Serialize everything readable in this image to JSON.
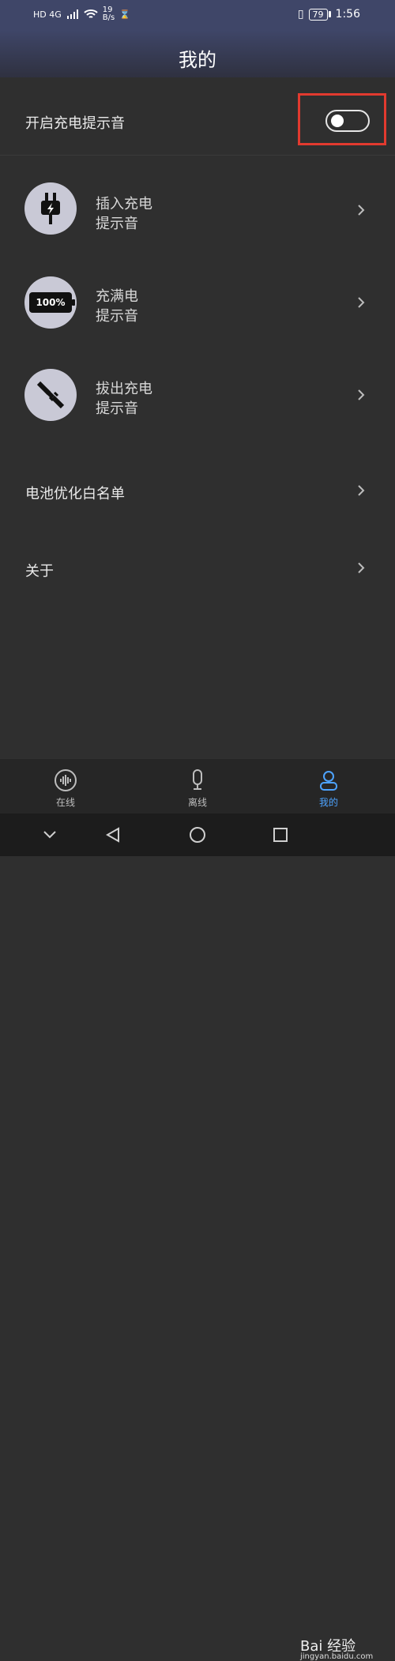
{
  "status": {
    "left_text": "HD 4G",
    "speed": "19\nB/s",
    "battery": "79",
    "time": "1:56"
  },
  "header": {
    "title": "我的"
  },
  "toggle_row": {
    "label": "开启充电提示音",
    "state": "off"
  },
  "items": [
    {
      "l1": "插入充电",
      "l2": "提示音",
      "icon": "plug-in-icon"
    },
    {
      "l1": "充满电",
      "l2": "提示音",
      "icon": "battery-full-icon"
    },
    {
      "l1": "拔出充电",
      "l2": "提示音",
      "icon": "unplug-icon"
    }
  ],
  "menu": {
    "battery_whitelist": "电池优化白名单",
    "about": "关于"
  },
  "battery_icon_text": "100%",
  "tabs": [
    {
      "label": "在线",
      "active": false,
      "icon": "sound-wave-icon"
    },
    {
      "label": "离线",
      "active": false,
      "icon": "mic-icon"
    },
    {
      "label": "我的",
      "active": true,
      "icon": "profile-icon"
    }
  ],
  "watermark": {
    "main": "Bai 经验",
    "sub": "jingyan.baidu.com"
  },
  "colors": {
    "header": "#3f4668",
    "background": "#2f2f2f",
    "accent": "#4da3ff",
    "highlight_box": "#e23a2f"
  }
}
